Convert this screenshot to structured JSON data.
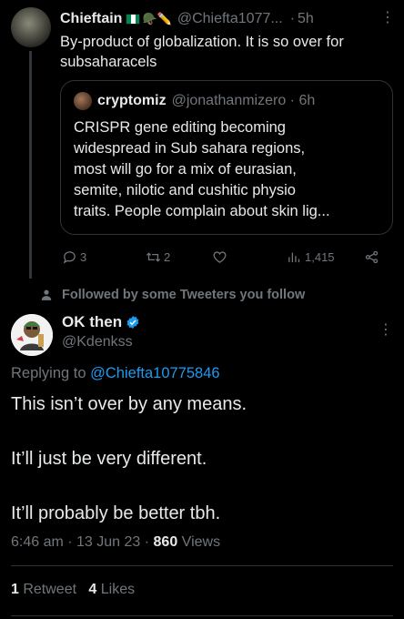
{
  "parent": {
    "name": "Chieftain",
    "emoji": "🪖✏️",
    "handle": "@Chiefta1077...",
    "dot": "·",
    "time": "5h",
    "more": "⋮",
    "text": "By-product of globalization. It is so over for subsaharacels",
    "flag_colors": [
      "#008751",
      "#ffffff",
      "#008751"
    ],
    "quote": {
      "name": "cryptomiz",
      "handle_time": "@jonathanmizero · 6h",
      "lines": [
        "CRISPR gene editing becoming",
        "widespread in Sub sahara regions,",
        "most will go for a mix of eurasian,",
        "semite, nilotic and cushitic physio",
        "traits. People complain about skin lig..."
      ]
    },
    "actions": {
      "replies": "3",
      "retweets": "2",
      "likes": "",
      "views": "1,415"
    }
  },
  "social_context": "Followed by some Tweeters you follow",
  "tweet": {
    "name": "OK then",
    "handle": "@Kdenkss",
    "more": "⋮",
    "replying_prefix": "Replying to ",
    "replying_handle": "@Chiefta10775846",
    "lines": [
      "This isn’t over by any means.",
      "It’ll just be very different.",
      "It’ll probably be better tbh."
    ],
    "timestamp": "6:46 am · 13 Jun 23 · ",
    "views_count": "860",
    "views_label": " Views",
    "retweet_count": "1",
    "retweet_label": " Retweet",
    "like_count": "4",
    "like_label": " Likes"
  },
  "colors": {
    "background": "#000000",
    "text": "#e7e9ea",
    "secondary": "#71767b",
    "link": "#1d9bf0",
    "verified": "#1d9bf0",
    "border": "#2f3336"
  },
  "icons": [
    "reply-icon",
    "retweet-icon",
    "like-icon",
    "views-icon",
    "share-icon",
    "person-icon",
    "verified-icon",
    "more-icon"
  ]
}
